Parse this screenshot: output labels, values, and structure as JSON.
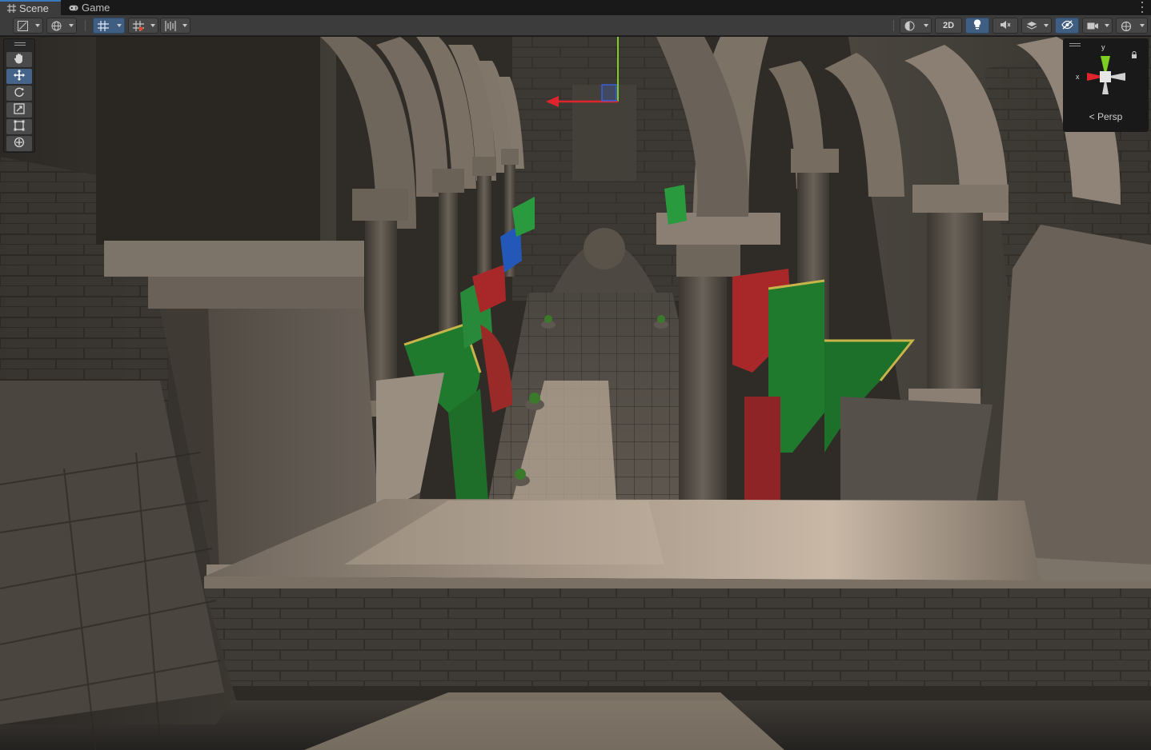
{
  "tabs": [
    {
      "label": "Scene",
      "icon": "grid-hash-icon",
      "active": true
    },
    {
      "label": "Game",
      "icon": "gamepad-icon",
      "active": false
    }
  ],
  "toolbar": {
    "left_controls": [
      "draw-mode-dropdown",
      "global-local-dropdown",
      "grid-snapping-dropdown",
      "incremental-snap-dropdown",
      "align-tools-dropdown"
    ],
    "right_controls": [
      "shading-mode-dropdown",
      "2d-toggle",
      "lighting-toggle",
      "audio-toggle",
      "effects-dropdown",
      "scene-visibility-toggle",
      "camera-dropdown",
      "gizmos-dropdown"
    ],
    "two_d_label": "2D"
  },
  "tools": [
    "view-tool",
    "move-tool",
    "rotate-tool",
    "scale-tool",
    "rect-tool",
    "transform-tool"
  ],
  "active_tool": "move-tool",
  "gizmo": {
    "projection_label": "Persp",
    "axis_y": "y",
    "axis_x": "x"
  },
  "colors": {
    "accent": "#3a79bb",
    "toggle_on": "#3f5e82",
    "axis_x": "#e0242c",
    "axis_y": "#7fcc23",
    "axis_z": "#3a5ed8"
  }
}
